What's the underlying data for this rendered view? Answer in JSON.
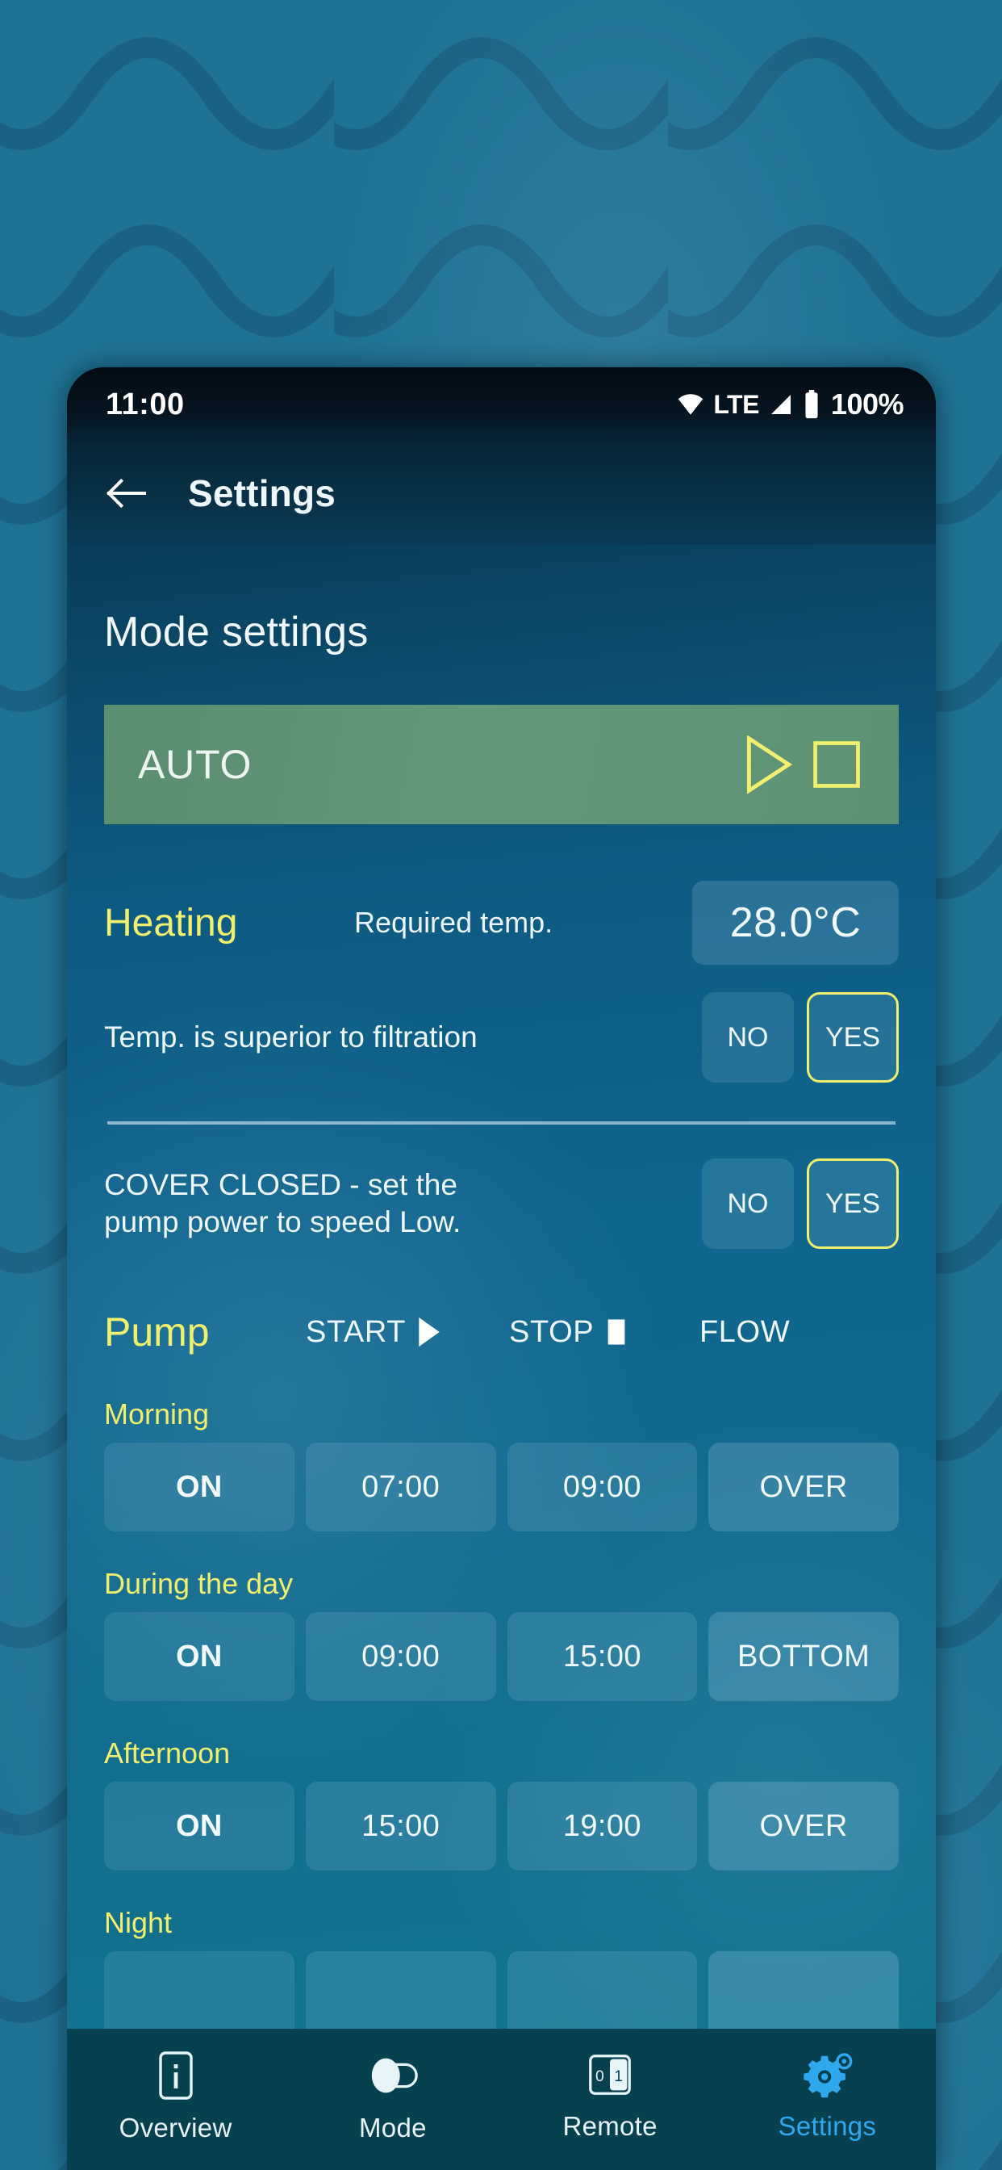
{
  "statusbar": {
    "time": "11:00",
    "network_label": "LTE",
    "battery_percent": "100%",
    "icons": [
      "wifi-icon",
      "signal-icon",
      "battery-icon"
    ]
  },
  "header": {
    "back_icon": "back-arrow-icon",
    "title": "Settings"
  },
  "main": {
    "section_title": "Mode settings",
    "mode_bar": {
      "label": "AUTO",
      "icons": [
        "play-outline-icon",
        "stop-outline-icon"
      ],
      "background_color": "#5e9274",
      "icon_color": "#f0ef6e"
    },
    "heating": {
      "label": "Heating",
      "required_temp_label": "Required temp.",
      "required_temp_value": "28.0°C",
      "superior_text": "Temp. is superior to filtration",
      "options": [
        "NO",
        "YES"
      ],
      "selected": "YES"
    },
    "cover": {
      "text": "COVER CLOSED - set the pump power to speed Low.",
      "text_line1": "COVER CLOSED - set the",
      "text_line2": "pump power to speed Low.",
      "options": [
        "NO",
        "YES"
      ],
      "selected": "YES"
    },
    "pump": {
      "label": "Pump",
      "col_start": "START",
      "col_stop": "STOP",
      "col_flow": "FLOW",
      "start_icon": "play-filled-icon",
      "stop_icon": "stop-filled-icon",
      "schedules": [
        {
          "name": "Morning",
          "state": "ON",
          "start": "07:00",
          "stop": "09:00",
          "flow": "OVER"
        },
        {
          "name": "During the day",
          "state": "ON",
          "start": "09:00",
          "stop": "15:00",
          "flow": "BOTTOM"
        },
        {
          "name": "Afternoon",
          "state": "ON",
          "start": "15:00",
          "stop": "19:00",
          "flow": "OVER"
        },
        {
          "name": "Night",
          "state": "",
          "start": "",
          "stop": "",
          "flow": ""
        }
      ]
    }
  },
  "bottomnav": {
    "active": "Settings",
    "items": [
      {
        "label": "Overview",
        "icon": "info-icon"
      },
      {
        "label": "Mode",
        "icon": "toggle-icon"
      },
      {
        "label": "Remote",
        "icon": "switch-0-1-icon"
      },
      {
        "label": "Settings",
        "icon": "gear-icon"
      }
    ],
    "active_color": "#2fa8ee"
  },
  "theme": {
    "accent_yellow": "#f0ef6e",
    "background_teal": "#1f7294",
    "app_blue": "#10658e"
  }
}
